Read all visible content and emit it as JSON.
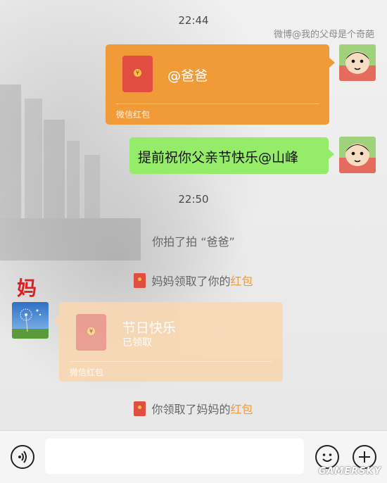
{
  "chat": {
    "time1": "22:44",
    "watermark": "微博@我的父母是个奇葩",
    "red_packet_1": {
      "coin": "¥",
      "title": "@爸爸",
      "label": "微信红包"
    },
    "green_message": "提前祝你父亲节快乐@山峰",
    "time2": "22:50",
    "pat_notice": "你拍了拍 “爸爸”",
    "claim_notice_1": {
      "prefix": "妈妈领取了你的",
      "link": "红包"
    },
    "sender_label": "妈",
    "red_packet_2": {
      "coin": "¥",
      "title": "节日快乐",
      "status": "已领取",
      "label": "微信红包"
    },
    "claim_notice_2": {
      "prefix": "你领取了妈妈的",
      "link": "红包"
    }
  },
  "colors": {
    "red_packet": "#f19a38",
    "red_packet_faded": "#f8d7b3",
    "green_bubble": "#95ec69",
    "envelope": "#e24d42",
    "link_orange": "#f19a38",
    "sender_label": "#e02020"
  },
  "icons": [
    "voice-icon",
    "emoji-icon",
    "plus-icon",
    "red-envelope-icon"
  ],
  "logo": "GAMERSKY"
}
